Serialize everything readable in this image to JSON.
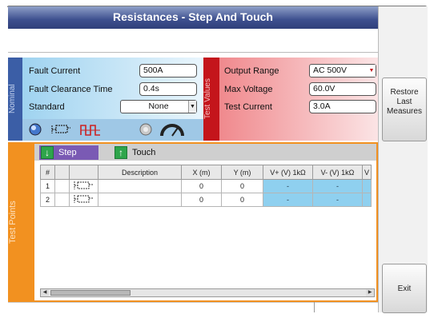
{
  "window": {
    "title": "Resistances - Step And Touch"
  },
  "sidebar": {
    "restore_label_1": "Restore",
    "restore_label_2": "Last",
    "restore_label_3": "Measures",
    "exit_label": "Exit"
  },
  "nominal": {
    "tab_label": "Nominal",
    "fault_current_label": "Fault Current",
    "fault_current_value": "500A",
    "fault_clearance_label": "Fault Clearance Time",
    "fault_clearance_value": "0.4s",
    "standard_label": "Standard",
    "standard_value": "None",
    "icons": [
      "electrode-icon",
      "hand-touch-icon",
      "step-wave-icon",
      "probe-icon",
      "gauge-icon"
    ]
  },
  "test_values": {
    "tab_label": "Test Values",
    "output_range_label": "Output Range",
    "output_range_value": "AC 500V",
    "max_voltage_label": "Max Voltage",
    "max_voltage_value": "60.0V",
    "test_current_label": "Test Current",
    "test_current_value": "3.0A"
  },
  "test_points": {
    "tab_label": "Test Points",
    "step_label": "Step",
    "touch_label": "Touch",
    "columns": [
      "#",
      "",
      "Description",
      "X (m)",
      "Y (m)",
      "V+ (V) 1kΩ",
      "V- (V) 1kΩ",
      "V"
    ],
    "rows": [
      {
        "num": "1",
        "desc": "",
        "x": "0",
        "y": "0",
        "vplus": "-",
        "vminus": "-",
        "v": ""
      },
      {
        "num": "2",
        "desc": "",
        "x": "0",
        "y": "0",
        "vplus": "-",
        "vminus": "-",
        "v": ""
      }
    ]
  },
  "colors": {
    "nominal": "#3b5ea6",
    "test_values": "#c4151b",
    "test_points": "#f29120",
    "step_tab": "#7a5ab4",
    "cell_blue": "#8fd0ef"
  }
}
